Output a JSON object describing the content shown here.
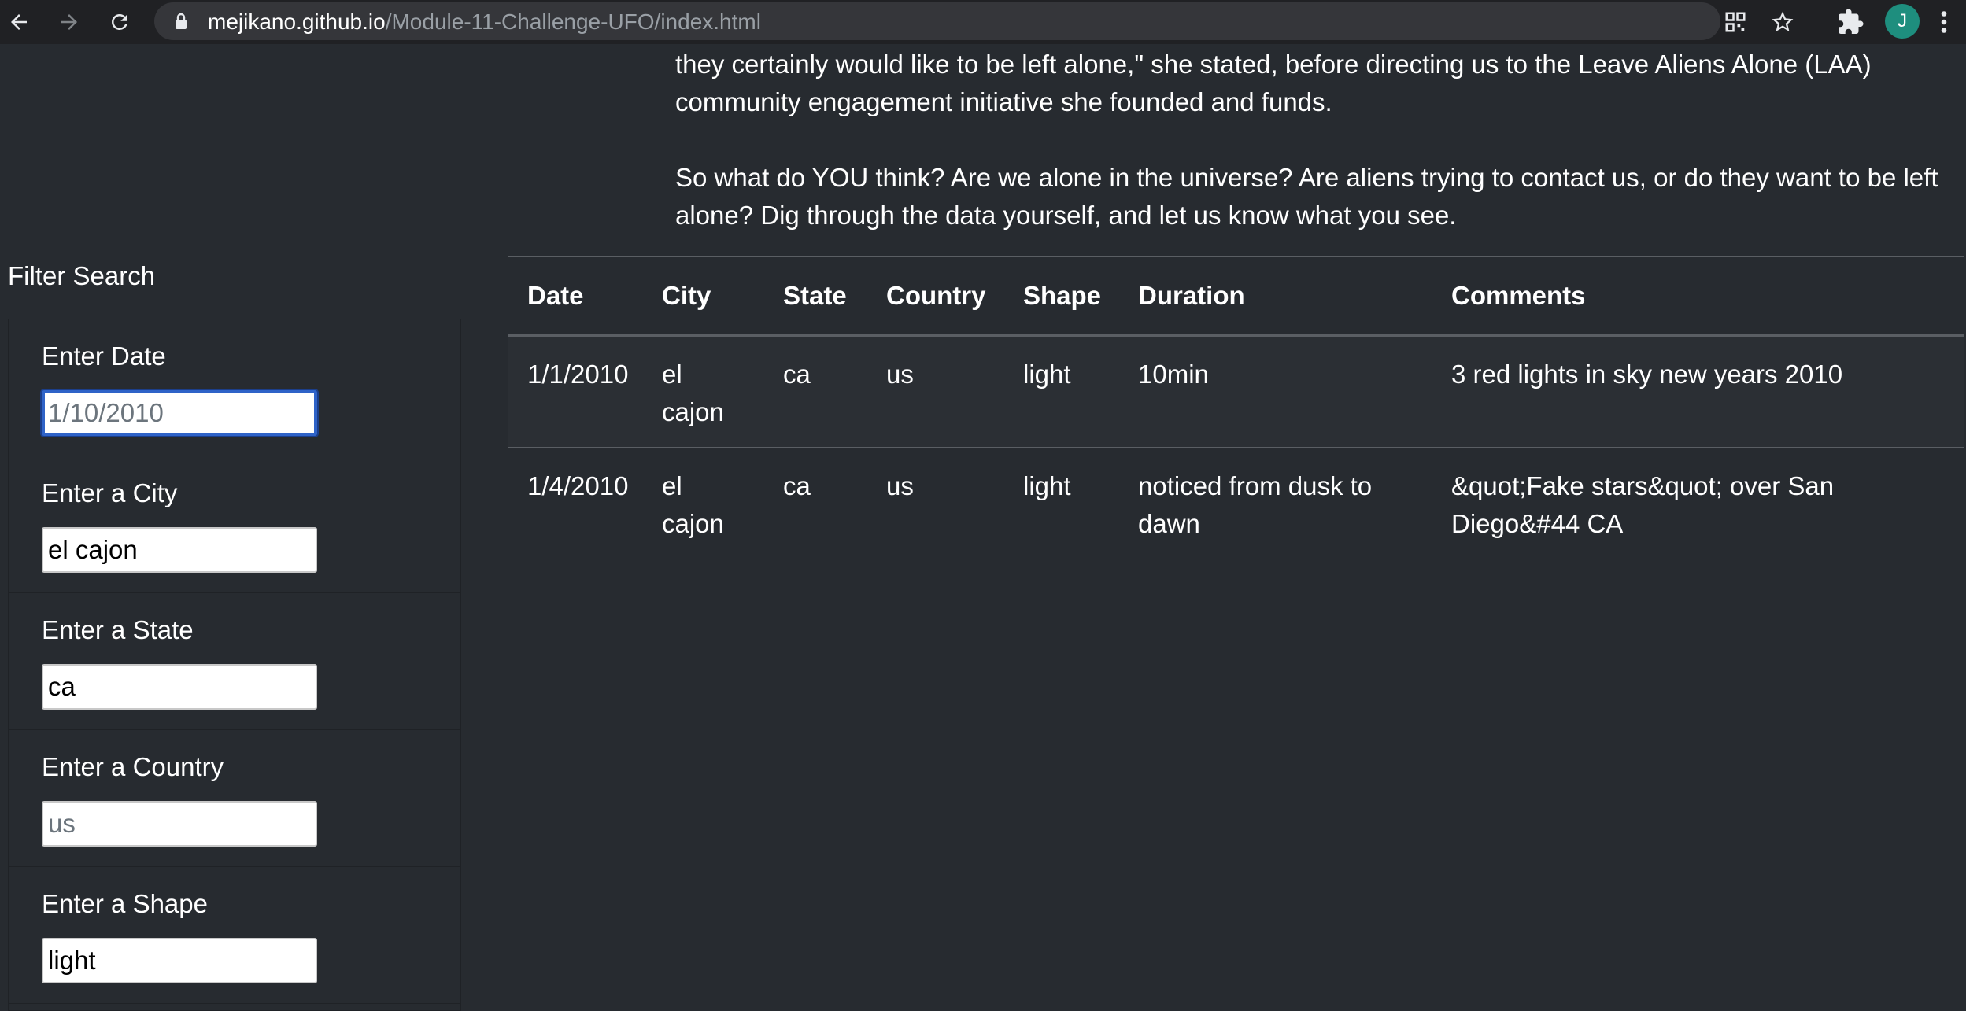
{
  "browser": {
    "url_host": "mejikano.github.io",
    "url_path": "/Module-11-Challenge-UFO/index.html",
    "avatar_letter": "J",
    "avatar_color": "#1e8e7e",
    "icons": [
      "back-arrow-icon",
      "forward-arrow-icon",
      "reload-icon",
      "lock-icon",
      "qr-code-icon",
      "bookmark-star-icon",
      "extensions-puzzle-icon",
      "menu-dots-icon"
    ]
  },
  "article": {
    "paragraph_1": "they certainly would like to be left alone,\" she stated, before directing us to the Leave Aliens Alone (LAA) community engagement initiative she founded and funds.",
    "paragraph_2": "So what do YOU think? Are we alone in the universe? Are aliens trying to contact us, or do they want to be left alone? Dig through the data yourself, and let us know what you see."
  },
  "filters": {
    "heading": "Filter Search",
    "date": {
      "label": "Enter Date",
      "value": "",
      "placeholder": "1/10/2010"
    },
    "city": {
      "label": "Enter a City",
      "value": "el cajon",
      "placeholder": ""
    },
    "state": {
      "label": "Enter a State",
      "value": "ca",
      "placeholder": ""
    },
    "country": {
      "label": "Enter a Country",
      "value": "",
      "placeholder": "us"
    },
    "shape": {
      "label": "Enter a Shape",
      "value": "light",
      "placeholder": ""
    }
  },
  "table": {
    "headers": {
      "date": "Date",
      "city": "City",
      "state": "State",
      "country": "Country",
      "shape": "Shape",
      "duration": "Duration",
      "comments": "Comments"
    },
    "rows": [
      {
        "date": "1/1/2010",
        "city": "el cajon",
        "state": "ca",
        "country": "us",
        "shape": "light",
        "duration": "10min",
        "comments": "3 red lights in sky new years 2010"
      },
      {
        "date": "1/4/2010",
        "city": "el cajon",
        "state": "ca",
        "country": "us",
        "shape": "light",
        "duration": "noticed from dusk to dawn",
        "comments": "&quot;Fake stars&quot; over San Diego&#44 CA"
      }
    ]
  }
}
